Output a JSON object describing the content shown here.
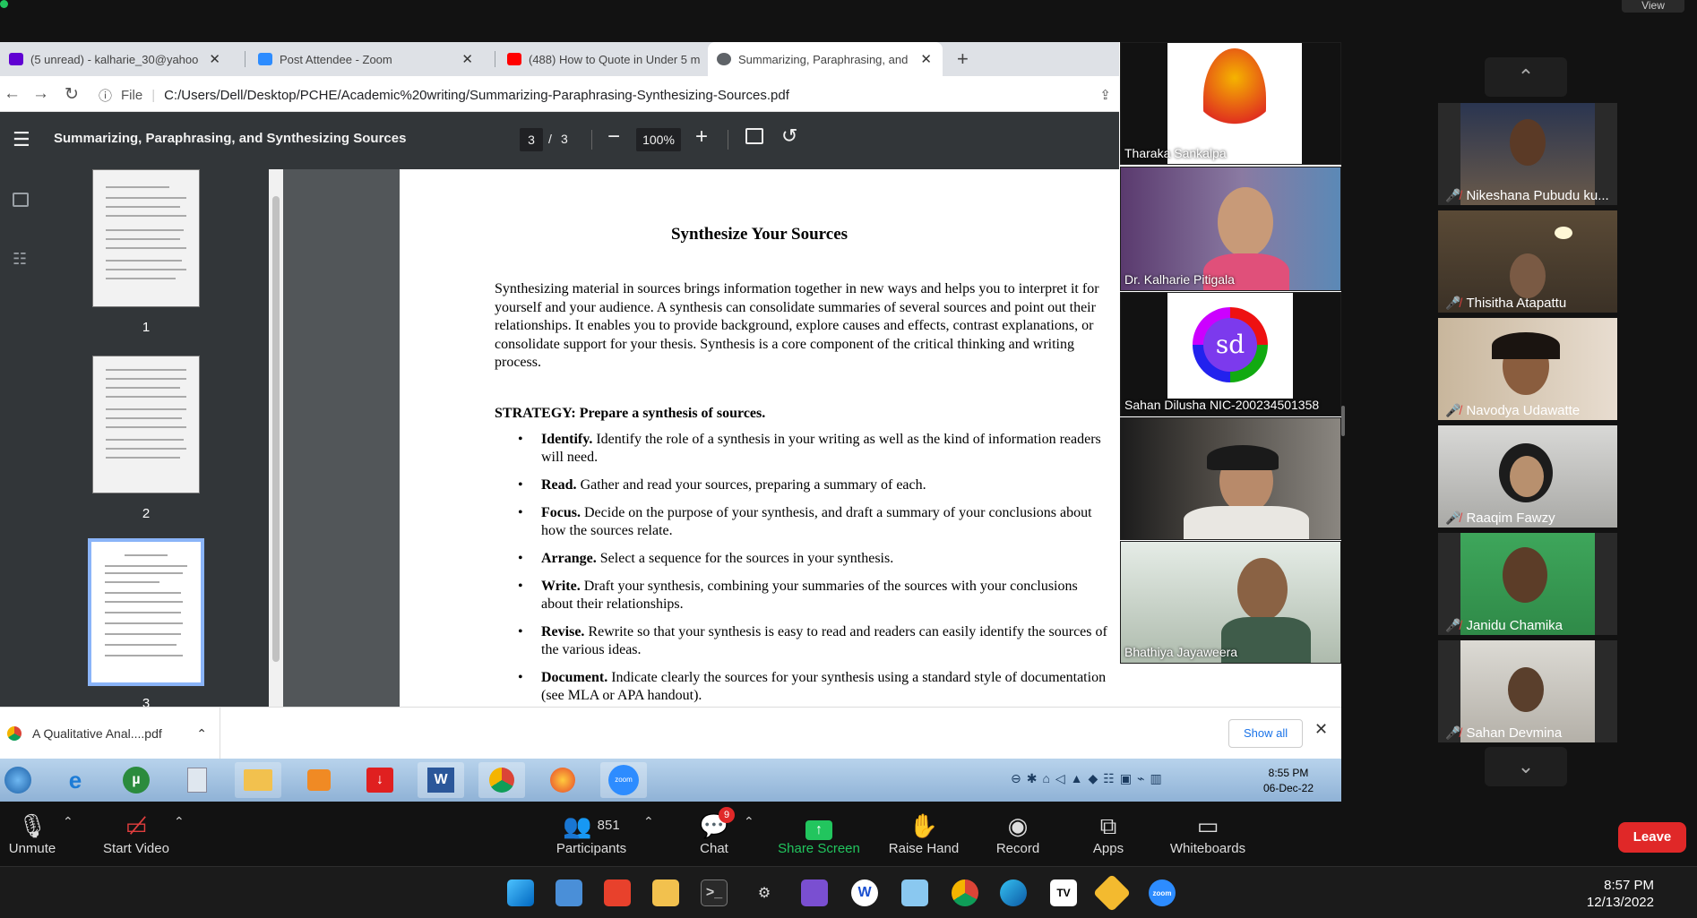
{
  "topbar": {
    "view_label": "View"
  },
  "chrome": {
    "tabs": [
      {
        "title": "(5 unread) - kalharie_30@yahoo"
      },
      {
        "title": "Post Attendee - Zoom"
      },
      {
        "title": "(488) How to Quote in Under 5 m"
      },
      {
        "title": "Summarizing, Paraphrasing, and"
      }
    ],
    "file_label": "File",
    "url": "C:/Users/Dell/Desktop/PCHE/Academic%20writing/Summarizing-Paraphrasing-Synthesizing-Sources.pdf"
  },
  "pdf": {
    "title": "Summarizing, Paraphrasing, and Synthesizing Sources",
    "page_current": "3",
    "page_sep": "/",
    "page_total": "3",
    "zoom": "100%",
    "thumbnails": [
      "1",
      "2",
      "3"
    ],
    "doc": {
      "heading": "Synthesize Your Sources",
      "paragraph": "Synthesizing material in sources brings information together in new ways and helps you to interpret it for yourself and your audience. A synthesis can consolidate summaries of several sources and point out their relationships. It enables you to provide background, explore causes and effects, contrast explanations, or consolidate support for your thesis.  Synthesis is a core component of the critical thinking and writing process.",
      "strategy": "STRATEGY: Prepare a synthesis of sources.",
      "steps": [
        {
          "term": "Identify.",
          "text": " Identify the role of a synthesis in your writing as well as the kind of information readers will need."
        },
        {
          "term": "Read.",
          "text": " Gather and read your sources, preparing a summary of each."
        },
        {
          "term": "Focus.",
          "text": " Decide on the purpose of your synthesis, and draft a summary of your conclusions about how the sources relate."
        },
        {
          "term": "Arrange.",
          "text": " Select a sequence for the sources in your synthesis."
        },
        {
          "term": "Write.",
          "text": " Draft your synthesis, combining your summaries of the sources with your conclusions about their relationships."
        },
        {
          "term": "Revise.",
          "text": " Rewrite so that your synthesis is easy to read and readers can easily identify the sources of the various ideas."
        },
        {
          "term": "Document.",
          "text": " Indicate clearly the sources for your synthesis using a standard style of documentation (see MLA or APA handout)."
        }
      ]
    }
  },
  "downloads": {
    "file": "A Qualitative Anal....pdf",
    "show_all": "Show all"
  },
  "win7": {
    "time": "8:55 PM",
    "date": "06-Dec-22"
  },
  "speakers": [
    {
      "name": "Tharaka Sankalpa"
    },
    {
      "name": "Dr. Kalharie Pitigala"
    },
    {
      "name": "Sahan Dilusha NIC-200234501358",
      "avatar": "sd"
    },
    {
      "name": ""
    },
    {
      "name": "Bhathiya Jayaweera"
    }
  ],
  "gallery": [
    {
      "name": "Nikeshana Pubudu ku..."
    },
    {
      "name": "Thisitha Atapattu"
    },
    {
      "name": "Navodya Udawatte"
    },
    {
      "name": "Raaqim Fawzy"
    },
    {
      "name": "Janidu Chamika"
    },
    {
      "name": "Sahan Devmina"
    }
  ],
  "zoom_controls": {
    "unmute": "Unmute",
    "start_video": "Start Video",
    "participants": "Participants",
    "participant_count": "851",
    "chat": "Chat",
    "chat_badge": "9",
    "share_screen": "Share Screen",
    "raise_hand": "Raise Hand",
    "record": "Record",
    "apps": "Apps",
    "whiteboards": "Whiteboards",
    "leave": "Leave"
  },
  "win11": {
    "time": "8:57 PM",
    "date": "12/13/2022"
  },
  "colors": {
    "share_green": "#22c55e",
    "leave_red": "#e02828",
    "mute_red": "#e03e3e"
  }
}
